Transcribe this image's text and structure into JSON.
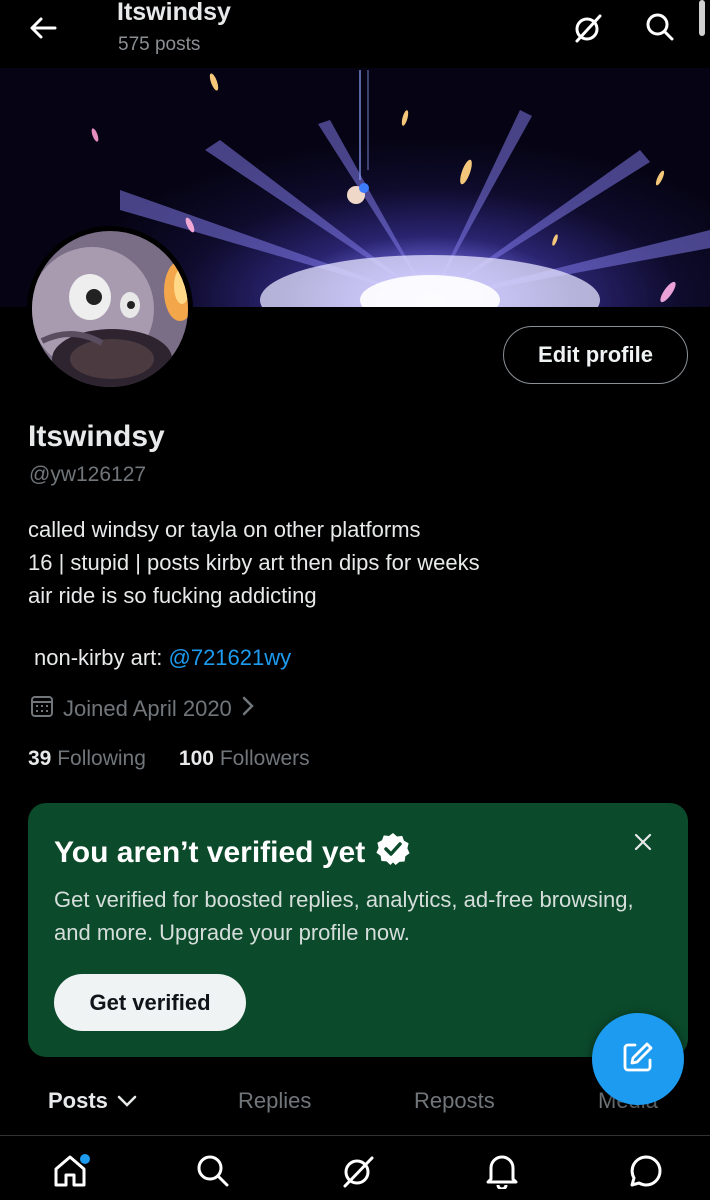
{
  "header": {
    "title": "Itswindsy",
    "post_count": "575 posts"
  },
  "profile": {
    "edit_label": "Edit profile",
    "name": "Itswindsy",
    "handle": "@yw126127",
    "bio_lines": [
      "called windsy or tayla on other platforms",
      "16 | stupid | posts kirby art then dips for weeks",
      "air ride is so fucking addicting"
    ],
    "nonkirby_label": "non-kirby art: ",
    "nonkirby_link": "@721621wy",
    "joined": "Joined April 2020",
    "following_count": "39",
    "following_label": "Following",
    "followers_count": "100",
    "followers_label": "Followers"
  },
  "verify_card": {
    "title": "You aren’t verified yet",
    "description": "Get verified for boosted replies, analytics, ad-free browsing, and more. Upgrade your profile now.",
    "button": "Get verified"
  },
  "tabs": [
    {
      "label": "Posts"
    },
    {
      "label": "Replies"
    },
    {
      "label": "Reposts"
    },
    {
      "label": "Media"
    }
  ],
  "icons": {
    "back": "back-arrow-icon",
    "grok": "grok-icon",
    "search": "search-icon",
    "calendar": "calendar-icon",
    "verified": "verified-badge-icon",
    "close": "close-icon",
    "compose": "compose-icon",
    "home": "home-icon",
    "notifications": "bell-icon",
    "messages": "messages-icon"
  },
  "colors": {
    "accent": "#1d9bf0",
    "card_bg": "#0b4a2b",
    "background": "#000000"
  }
}
